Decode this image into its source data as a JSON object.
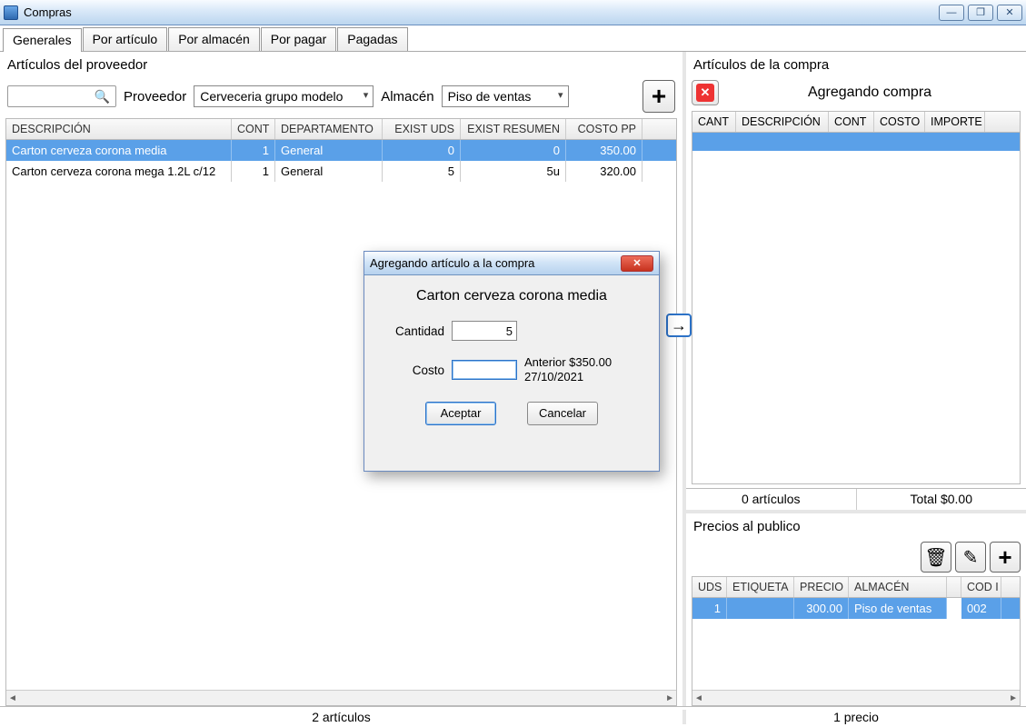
{
  "window": {
    "title": "Compras"
  },
  "tabs": [
    "Generales",
    "Por artículo",
    "Por almacén",
    "Por pagar",
    "Pagadas"
  ],
  "activeTab": 0,
  "provider": {
    "sectionLabel": "Artículos del proveedor",
    "providerLabel": "Proveedor",
    "providerValue": "Cerveceria grupo modelo",
    "warehouseLabel": "Almacén",
    "warehouseValue": "Piso de ventas",
    "columns": [
      "DESCRIPCIÓN",
      "CONT",
      "DEPARTAMENTO",
      "EXIST UDS",
      "EXIST RESUMEN",
      "COSTO PP"
    ],
    "rows": [
      {
        "desc": "Carton cerveza corona media",
        "cont": "1",
        "dept": "General",
        "exuds": "0",
        "exres": "0",
        "costo": "350.00",
        "selected": true
      },
      {
        "desc": "Carton cerveza corona mega 1.2L c/12",
        "cont": "1",
        "dept": "General",
        "exuds": "5",
        "exres": "5u",
        "costo": "320.00",
        "selected": false
      }
    ],
    "status": "2 artículos"
  },
  "purchase": {
    "sectionLabel": "Artículos de la compra",
    "title": "Agregando compra",
    "columns": [
      "CANT",
      "DESCRIPCIÓN",
      "CONT",
      "COSTO",
      "IMPORTE"
    ],
    "footerLeft": "0 artículos",
    "footerRight": "Total $0.00"
  },
  "prices": {
    "sectionLabel": "Precios al publico",
    "columns": [
      "UDS",
      "ETIQUETA",
      "PRECIO",
      "ALMACÉN",
      "",
      "COD I"
    ],
    "rows": [
      {
        "uds": "1",
        "etiqueta": "",
        "precio": "300.00",
        "almacen": "Piso de ventas",
        "cod": "002"
      }
    ],
    "status": "1 precio"
  },
  "dialog": {
    "title": "Agregando artículo a la compra",
    "article": "Carton cerveza corona media",
    "qtyLabel": "Cantidad",
    "qtyValue": "5",
    "costLabel": "Costo",
    "costValue": "",
    "prevLine1": "Anterior $350.00",
    "prevLine2": "27/10/2021",
    "accept": "Aceptar",
    "cancel": "Cancelar"
  }
}
